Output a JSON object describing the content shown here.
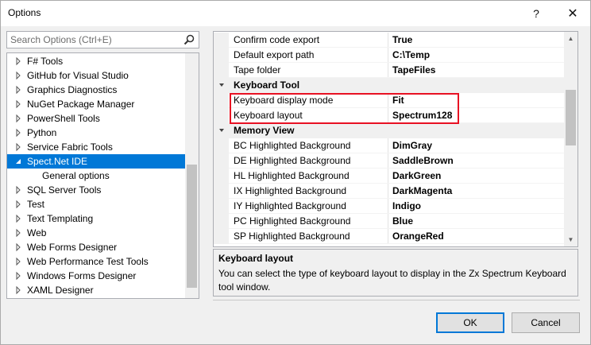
{
  "window": {
    "title": "Options",
    "help_label": "?",
    "close_label": "✕"
  },
  "search": {
    "placeholder": "Search Options (Ctrl+E)"
  },
  "tree": {
    "items": [
      {
        "label": "F# Tools",
        "expanded": false
      },
      {
        "label": "GitHub for Visual Studio",
        "expanded": false
      },
      {
        "label": "Graphics Diagnostics",
        "expanded": false
      },
      {
        "label": "NuGet Package Manager",
        "expanded": false
      },
      {
        "label": "PowerShell Tools",
        "expanded": false
      },
      {
        "label": "Python",
        "expanded": false
      },
      {
        "label": "Service Fabric Tools",
        "expanded": false
      },
      {
        "label": "Spect.Net IDE",
        "expanded": true,
        "selected": true
      },
      {
        "label": "General options",
        "child": true
      },
      {
        "label": "SQL Server Tools",
        "expanded": false
      },
      {
        "label": "Test",
        "expanded": false
      },
      {
        "label": "Text Templating",
        "expanded": false
      },
      {
        "label": "Web",
        "expanded": false
      },
      {
        "label": "Web Forms Designer",
        "expanded": false
      },
      {
        "label": "Web Performance Test Tools",
        "expanded": false
      },
      {
        "label": "Windows Forms Designer",
        "expanded": false
      },
      {
        "label": "XAML Designer",
        "expanded": false
      }
    ]
  },
  "grid": {
    "rows": [
      {
        "type": "prop",
        "name": "Confirm code export",
        "value": "True"
      },
      {
        "type": "prop",
        "name": "Default export path",
        "value": "C:\\Temp"
      },
      {
        "type": "prop",
        "name": "Tape folder",
        "value": "TapeFiles"
      },
      {
        "type": "category",
        "name": "Keyboard Tool"
      },
      {
        "type": "prop",
        "name": "Keyboard display mode",
        "value": "Fit"
      },
      {
        "type": "prop",
        "name": "Keyboard layout",
        "value": "Spectrum128"
      },
      {
        "type": "category",
        "name": "Memory View"
      },
      {
        "type": "prop",
        "name": "BC Highlighted Background",
        "value": "DimGray"
      },
      {
        "type": "prop",
        "name": "DE Highlighted Background",
        "value": "SaddleBrown"
      },
      {
        "type": "prop",
        "name": "HL Highlighted Background",
        "value": "DarkGreen"
      },
      {
        "type": "prop",
        "name": "IX Highlighted Background",
        "value": "DarkMagenta"
      },
      {
        "type": "prop",
        "name": "IY Highlighted Background",
        "value": "Indigo"
      },
      {
        "type": "prop",
        "name": "PC Highlighted Background",
        "value": "Blue"
      },
      {
        "type": "prop",
        "name": "SP Highlighted Background",
        "value": "OrangeRed"
      }
    ]
  },
  "description": {
    "title": "Keyboard layout",
    "text": "You can select the type of keyboard layout to display in the Zx Spectrum Keyboard tool window."
  },
  "buttons": {
    "ok": "OK",
    "cancel": "Cancel"
  },
  "colors": {
    "selection": "#0078d7",
    "highlight_border": "#e81123"
  }
}
